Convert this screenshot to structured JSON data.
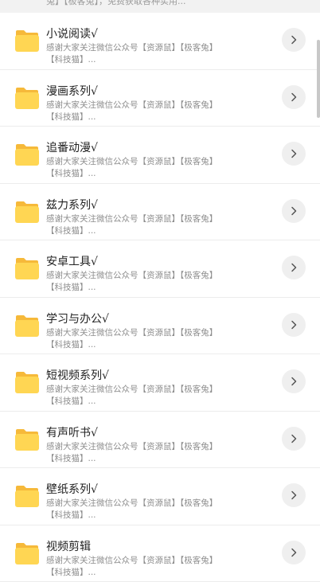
{
  "top_partial_text": "兔】【极客兔】，免费获取各种实用...",
  "items": [
    {
      "title": "小说阅读√",
      "desc": "感谢大家关注微信公众号【资源鼠】【极客兔】【科技猫】..."
    },
    {
      "title": "漫画系列√",
      "desc": "感谢大家关注微信公众号【资源鼠】【极客兔】【科技猫】..."
    },
    {
      "title": "追番动漫√",
      "desc": "感谢大家关注微信公众号【资源鼠】【极客兔】【科技猫】..."
    },
    {
      "title": "兹力系列√",
      "desc": "感谢大家关注微信公众号【资源鼠】【极客兔】【科技猫】..."
    },
    {
      "title": "安卓工具√",
      "desc": "感谢大家关注微信公众号【资源鼠】【极客兔】【科技猫】..."
    },
    {
      "title": "学习与办公√",
      "desc": "感谢大家关注微信公众号【资源鼠】【极客兔】【科技猫】..."
    },
    {
      "title": "短视频系列√",
      "desc": "感谢大家关注微信公众号【资源鼠】【极客兔】【科技猫】..."
    },
    {
      "title": "有声听书√",
      "desc": "感谢大家关注微信公众号【资源鼠】【极客兔】【科技猫】..."
    },
    {
      "title": "壁纸系列√",
      "desc": "感谢大家关注微信公众号【资源鼠】【极客兔】【科技猫】..."
    },
    {
      "title": "视频剪辑",
      "desc": "感谢大家关注微信公众号【资源鼠】【极客兔】【科技猫】..."
    }
  ],
  "colors": {
    "folder_front": "#ffd653",
    "folder_back": "#f6b93a",
    "arrow_bg": "#efefef",
    "arrow_icon": "#555555"
  },
  "icons": {
    "folder": "folder-icon",
    "arrow": "chevron-right-icon"
  }
}
